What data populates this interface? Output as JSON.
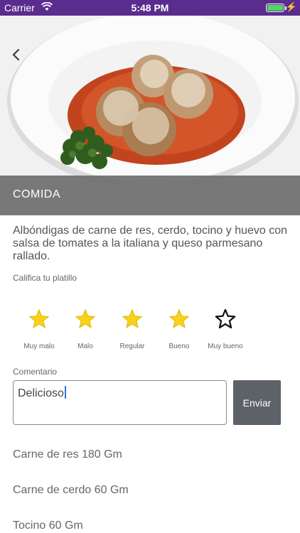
{
  "status_bar": {
    "carrier": "Carrier",
    "time": "5:48 PM",
    "battery_level": 1.0
  },
  "header": {
    "category": "COMIDA"
  },
  "description": "Albóndigas de carne de res, cerdo, tocino y huevo con salsa de tomates a la italiana y queso parmesano rallado.",
  "rating": {
    "prompt": "Califica tu platillo",
    "selected": 4,
    "options": [
      "Muy malo",
      "Malo",
      "Regular",
      "Bueno",
      "Muy bueno"
    ]
  },
  "comment": {
    "label": "Comentario",
    "value": "Delicioso",
    "button_label": "Enviar"
  },
  "ingredients": [
    "Carne de res 180 Gm",
    "Carne de cerdo 60 Gm",
    "Tocino 60 Gm"
  ],
  "colors": {
    "status_bar": "#5a2c8e",
    "star_filled": "#f8d11c",
    "button": "#5d6168",
    "caption": "#6e6e6e"
  }
}
